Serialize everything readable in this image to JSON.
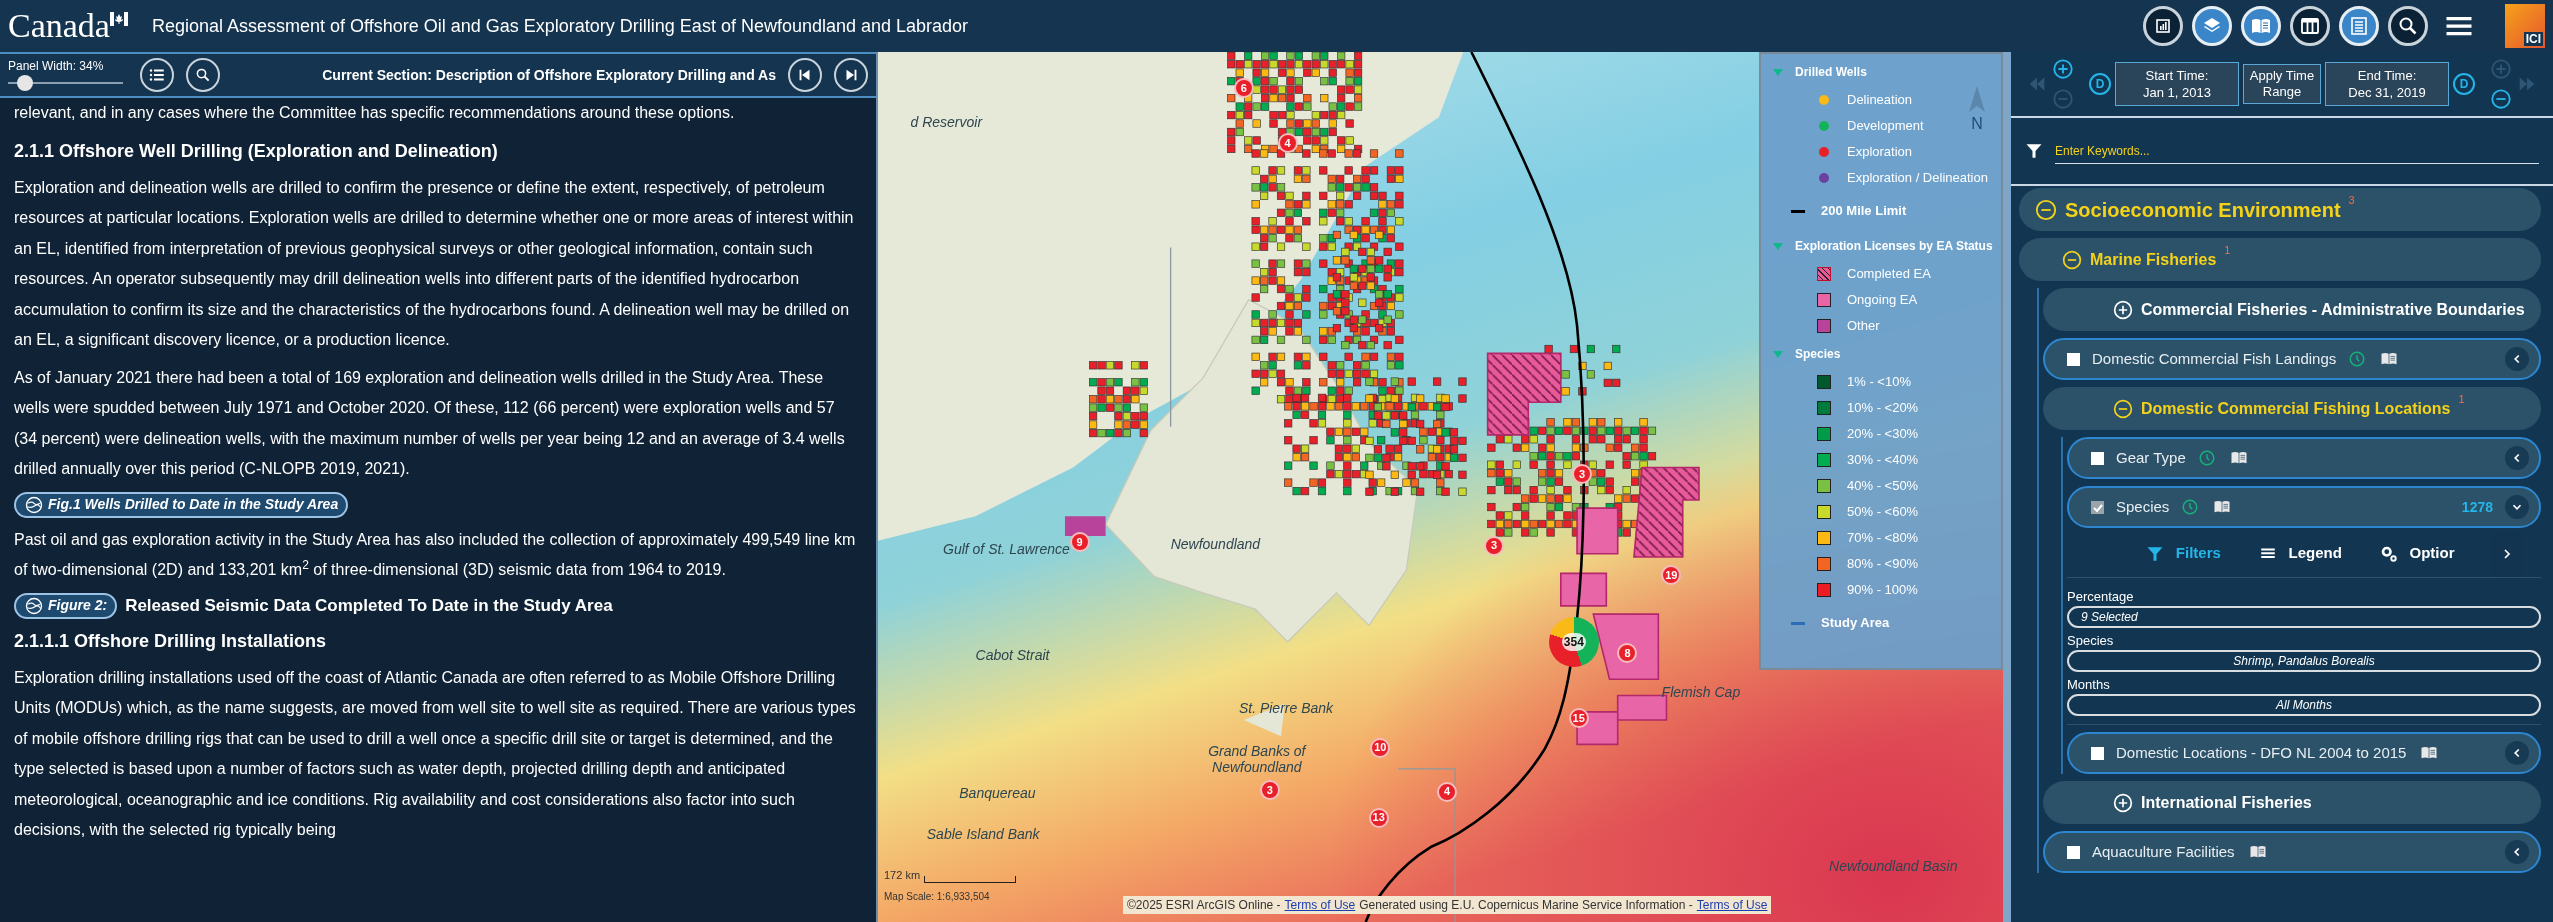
{
  "header": {
    "wordmark": "Canada",
    "title": "Regional Assessment of Offshore Oil and Gas Exploratory Drilling East of Newfoundland and Labrador",
    "tools": [
      {
        "kind": "chart",
        "active": false
      },
      {
        "kind": "layers",
        "active": true
      },
      {
        "kind": "book",
        "active": true
      },
      {
        "kind": "table",
        "active": false
      },
      {
        "kind": "list",
        "active": true
      },
      {
        "kind": "search",
        "active": false
      },
      {
        "kind": "menu"
      }
    ],
    "logo": "ICI"
  },
  "left_panel": {
    "panel_width": {
      "label": "Panel Width: 34%",
      "level": 0.15
    },
    "section_title": "Current Section: Description of Offshore Exploratory Drilling and As",
    "content": [
      {
        "kind": "text",
        "text": "relevant, and in any cases where the Committee has specific recommendations around these options."
      },
      {
        "kind": "heading",
        "text": "2.1.1 Offshore Well Drilling (Exploration and Delineation)"
      },
      {
        "kind": "text",
        "text": "Exploration and delineation wells are drilled to confirm the presence or define the extent, respectively, of petroleum resources at particular locations. Exploration wells are drilled to determine whether one or more areas of interest within an EL, identified from interpretation of previous geophysical surveys or other geological information, contain such resources. An operator subsequently may drill delineation wells into different parts of the identified hydrocarbon accumulation to confirm its size and the characteristics of the hydrocarbons found. A delineation well may be drilled on an EL, a significant discovery licence, or a production licence."
      },
      {
        "kind": "text",
        "text": "As of January 2021 there had been a total of 169 exploration and delineation wells drilled in the Study Area. These wells were spudded between July 1971 and October 2020. Of these, 112 (66 percent) were exploration wells and 57 (34 percent) were delineation wells, with the maximum number of wells per year being 12 and an average of 3.4 wells drilled annually over this period (C-NLOPB 2019, 2021)."
      },
      {
        "kind": "figure",
        "label": "Fig.1 Wells Drilled to Date in the Study Area"
      },
      {
        "kind": "text",
        "text": "Past oil and gas exploration activity in the Study Area has also included the collection of approximately 499,549 line km of two-dimensional (2D) and 133,201 km$^{2}$ of three-dimensional (3D) seismic data from 1964 to 2019."
      },
      {
        "kind": "figure",
        "label": "Figure 2:",
        "caption": "Released Seismic Data Completed To Date in the Study Area"
      },
      {
        "kind": "heading",
        "text": "2.1.1.1 Offshore Drilling Installations"
      },
      {
        "kind": "text",
        "text": "Exploration drilling installations used off the coast of Atlantic Canada are often referred to as Mobile Offshore Drilling Units (MODUs) which, as the name suggests, are moved from well site to well site as required. There are various types of mobile offshore drilling rigs that can be used to drill a well once a specific drill site or target is determined, and the type selected is based upon a number of factors such as water depth, projected drilling depth and anticipated meteorological, oceanographic and ice conditions. Rig availability and cost considerations also factor into such decisions, with the selected rig typically being"
      }
    ]
  },
  "map": {
    "places": [
      "d Reservoir",
      "Gulf of St. Lawrence",
      "Newfoundland",
      "Cabot Strait",
      "St. Pierre Bank",
      "Grand Banks of Newfoundland",
      "Banquereau",
      "Sable Island Bank",
      "Flemish Cap",
      "Newfoundland Basin"
    ],
    "clusters": [
      {
        "kind": "count",
        "label": "6"
      },
      {
        "kind": "count",
        "label": "4"
      },
      {
        "kind": "count",
        "label": "9"
      },
      {
        "kind": "count",
        "label": "3"
      },
      {
        "kind": "count",
        "label": "3"
      },
      {
        "kind": "count",
        "label": "19"
      },
      {
        "kind": "pie",
        "label": "354"
      },
      {
        "kind": "count",
        "label": "8"
      },
      {
        "kind": "count",
        "label": "15"
      },
      {
        "kind": "count",
        "label": "10"
      },
      {
        "kind": "count",
        "label": "3"
      },
      {
        "kind": "count",
        "label": "4"
      },
      {
        "kind": "count",
        "label": "13"
      }
    ],
    "north": "N",
    "legend": [
      {
        "kind": "section",
        "title": "Drilled Wells",
        "expanded": true,
        "items": [
          {
            "kind": "dot",
            "label": "Delineation",
            "color": "#f9b917"
          },
          {
            "kind": "dot",
            "label": "Development",
            "color": "#14b35a"
          },
          {
            "kind": "dot",
            "label": "Exploration",
            "color": "#e8202a"
          },
          {
            "kind": "dot",
            "label": "Exploration / Delineation",
            "color": "#6a40a0"
          }
        ]
      },
      {
        "kind": "line",
        "label": "200 Mile Limit",
        "color": "#000000"
      },
      {
        "kind": "section",
        "title": "Exploration Licenses by EA Status",
        "expanded": true,
        "items": [
          {
            "kind": "hatch",
            "label": "Completed EA",
            "color": "#e85a9a"
          },
          {
            "kind": "square",
            "label": "Ongoing EA",
            "color": "#e866a8"
          },
          {
            "kind": "square",
            "label": "Other",
            "color": "#b8439a"
          }
        ]
      },
      {
        "kind": "section",
        "title": "Species",
        "expanded": true,
        "items": [
          {
            "kind": "square",
            "label": "1% - <10%",
            "color": "#00592e"
          },
          {
            "kind": "square",
            "label": "10% - <20%",
            "color": "#007a3d"
          },
          {
            "kind": "square",
            "label": "20% - <30%",
            "color": "#009a49"
          },
          {
            "kind": "square",
            "label": "30% - <40%",
            "color": "#00ac4f"
          },
          {
            "kind": "square",
            "label": "40% - <50%",
            "color": "#7ac143"
          },
          {
            "kind": "square",
            "label": "50% - <60%",
            "color": "#c8d92b"
          },
          {
            "kind": "square",
            "label": "70% - <80%",
            "color": "#fdb913"
          },
          {
            "kind": "square",
            "label": "80% - <90%",
            "color": "#f26522"
          },
          {
            "kind": "square",
            "label": "90% - 100%",
            "color": "#ed1c24"
          }
        ]
      },
      {
        "kind": "line",
        "label": "Study Area",
        "color": "#2e6db4"
      }
    ],
    "scale": {
      "distance": "172 km",
      "ratio": "Map Scale: 1:6,933,504"
    },
    "attribution": [
      {
        "kind": "text",
        "text": "©2025 ESRI ArcGIS Online -"
      },
      {
        "kind": "link",
        "text": "Terms of Use"
      },
      {
        "kind": "text",
        "text": "Generated using E.U. Copernicus Marine Service Information -"
      },
      {
        "kind": "link",
        "text": "Terms of Use"
      }
    ]
  },
  "right_panel": {
    "time": {
      "left_controls": [
        {
          "kind": "rewind",
          "disabled": true
        },
        {
          "kind": "zoom_in",
          "disabled": false
        },
        {
          "kind": "zoom_out",
          "disabled": true
        }
      ],
      "start_mark": "D",
      "start_label": "Start Time:",
      "start": "Jan 1, 2013",
      "apply": "Apply Time Range",
      "end_label": "End Time:",
      "end": "Dec 31, 2019",
      "end_mark": "D",
      "right_controls": [
        {
          "kind": "zoom_in",
          "disabled": true
        },
        {
          "kind": "zoom_out",
          "disabled": false
        },
        {
          "kind": "forward",
          "disabled": true
        }
      ]
    },
    "filter": {
      "placeholder": "Enter Keywords..."
    },
    "layers": [
      {
        "kind": "group",
        "label": "Socioeconomic Environment",
        "count": "3",
        "expanded": true,
        "children": [
          {
            "kind": "group",
            "label": "Marine Fisheries",
            "count": "1",
            "expanded": true,
            "children": [
              {
                "kind": "group",
                "label": "Commercial Fisheries - Administrative Boundaries",
                "expanded": false
              },
              {
                "kind": "layer",
                "label": "Domestic Commercial Fish Landings",
                "checked": false,
                "time": true,
                "expanded": false
              },
              {
                "kind": "group",
                "label": "Domestic Commercial Fishing Locations",
                "count": "1",
                "expanded": true,
                "children": [
                  {
                    "kind": "layer",
                    "label": "Gear Type",
                    "checked": false,
                    "time": true,
                    "expanded": false
                  },
                  {
                    "kind": "layer",
                    "label": "Species",
                    "checked": true,
                    "time": true,
                    "count": "1278",
                    "expanded": true,
                    "tabs": [
                      {
                        "kind": "filter",
                        "label": "Filters",
                        "selected": true
                      },
                      {
                        "kind": "legend",
                        "label": "Legend",
                        "selected": false
                      },
                      {
                        "kind": "options",
                        "label": "Optior",
                        "selected": false
                      }
                    ],
                    "fields": [
                      {
                        "kind": "multiselect",
                        "label": "Percentage",
                        "value": "9 Selected"
                      },
                      {
                        "kind": "select",
                        "label": "Species",
                        "value": "Shrimp, Pandalus Borealis"
                      },
                      {
                        "kind": "select",
                        "label": "Months",
                        "value": "All Months"
                      }
                    ]
                  },
                  {
                    "kind": "layer",
                    "label": "Domestic Locations - DFO NL 2004 to 2015",
                    "checked": false,
                    "time": false,
                    "expanded": false
                  }
                ]
              },
              {
                "kind": "group",
                "label": "International Fisheries",
                "expanded": false
              },
              {
                "kind": "layer",
                "label": "Aquaculture Facilities",
                "checked": false,
                "time": false,
                "expanded": false
              }
            ]
          }
        ]
      }
    ]
  }
}
